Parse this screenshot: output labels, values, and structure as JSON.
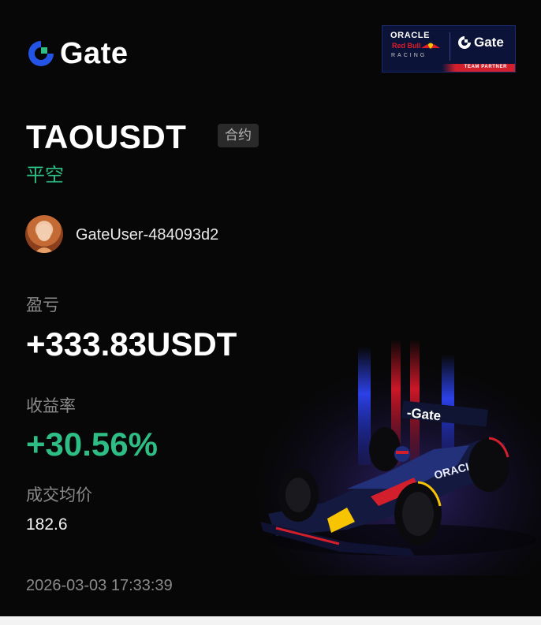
{
  "brand": {
    "logo_text": "Gate",
    "logo_icon": "gate-logo-icon",
    "colors": {
      "accent_blue": "#2354e6",
      "accent_green": "#2ebd85"
    }
  },
  "partner_badge": {
    "line1": "ORACLE",
    "line2": "Red Bull",
    "line3": "RACING",
    "gate_text": "Gate",
    "team_label": "TEAM PARTNER"
  },
  "trade": {
    "pair": "TAOUSDT",
    "contract_tag": "合约",
    "side": "平空"
  },
  "user": {
    "avatar_icon": "user-avatar",
    "name": "GateUser-484093d2"
  },
  "stats": {
    "pnl_label": "盈亏",
    "pnl_value": "+333.83USDT",
    "roi_label": "收益率",
    "roi_value": "+30.56%",
    "avg_price_label": "成交均价",
    "avg_price_value": "182.6"
  },
  "timestamp": "2026-03-03 17:33:39",
  "car_livery": "-Gate"
}
